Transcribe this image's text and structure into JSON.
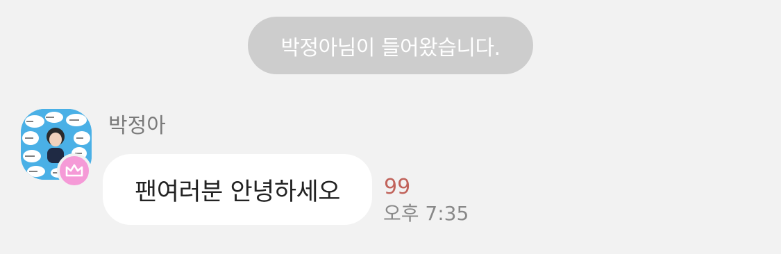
{
  "system_message": "박정아님이 들어왔습니다.",
  "message": {
    "sender_name": "박정아",
    "avatar_icon": "profile-photo-avatar",
    "badge_icon": "crown-icon",
    "badge_color": "#f59ad7",
    "text": "팬여러분 안녕하세오",
    "unread_count": "99",
    "time": "오후 7:35"
  },
  "colors": {
    "background": "#f2f2f2",
    "system_pill": "#cdcdcd",
    "bubble": "#ffffff",
    "unread": "#c1635b"
  }
}
